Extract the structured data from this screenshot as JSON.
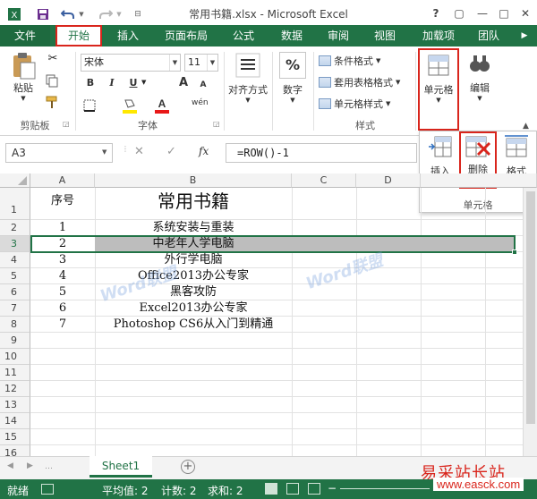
{
  "window": {
    "title": "常用书籍.xlsx - Microsoft Excel"
  },
  "quick_access": {
    "save_icon": "save-icon",
    "undo_icon": "undo-icon",
    "redo_icon": "redo-icon"
  },
  "title_controls": {
    "help": "?",
    "restore": "▢",
    "minimize": "—",
    "maximize": "□",
    "close": "✕"
  },
  "tabs": [
    "文件",
    "开始",
    "插入",
    "页面布局",
    "公式",
    "数据",
    "审阅",
    "视图",
    "加载项",
    "团队"
  ],
  "active_tab": "开始",
  "ribbon": {
    "clipboard": {
      "paste": "粘贴",
      "group": "剪贴板"
    },
    "font": {
      "name": "宋体",
      "size": "11",
      "bold": "B",
      "italic": "I",
      "underline": "U",
      "grow": "A",
      "shrink": "A",
      "wen": "wén",
      "group": "字体"
    },
    "alignment": {
      "label": "对齐方式"
    },
    "number": {
      "label": "数字",
      "symbol": "%"
    },
    "styles": {
      "conditional": "条件格式",
      "table": "套用表格格式",
      "cell": "单元格样式",
      "group": "样式"
    },
    "cells": {
      "label": "单元格"
    },
    "editing": {
      "label": "编辑"
    }
  },
  "cells_panel": {
    "insert": "插入",
    "delete": "删除",
    "format": "格式",
    "group": "单元格"
  },
  "formula_bar": {
    "name_box": "A3",
    "cancel": "✕",
    "enter": "✓",
    "fx": "fx",
    "formula": "=ROW()-1"
  },
  "grid": {
    "columns": [
      "A",
      "B",
      "C",
      "D"
    ],
    "rows": [
      "1",
      "2",
      "3",
      "4",
      "5",
      "6",
      "7",
      "8",
      "9",
      "10",
      "11",
      "12",
      "13",
      "14",
      "15",
      "16"
    ],
    "header_a": "序号",
    "header_b": "常用书籍",
    "data": [
      {
        "a": "1",
        "b": "系统安装与重装"
      },
      {
        "a": "2",
        "b": "中老年人学电脑"
      },
      {
        "a": "3",
        "b": "外行学电脑"
      },
      {
        "a": "4",
        "b": "Office2013办公专家"
      },
      {
        "a": "5",
        "b": "黑客攻防"
      },
      {
        "a": "6",
        "b": "Excel2013办公专家"
      },
      {
        "a": "7",
        "b": "Photoshop CS6从入门到精通"
      }
    ]
  },
  "sheets": {
    "tab": "Sheet1",
    "add": "+"
  },
  "status": {
    "ready": "就绪",
    "average": "平均值: 2",
    "count": "计数: 2",
    "sum": "求和: 2"
  },
  "watermark": {
    "site_cn": "易采站长站",
    "site_url": "www.easck.com"
  },
  "colors": {
    "excel_green": "#217346",
    "highlight_red": "#d9251c",
    "selected_row": "#bdbdbd"
  }
}
